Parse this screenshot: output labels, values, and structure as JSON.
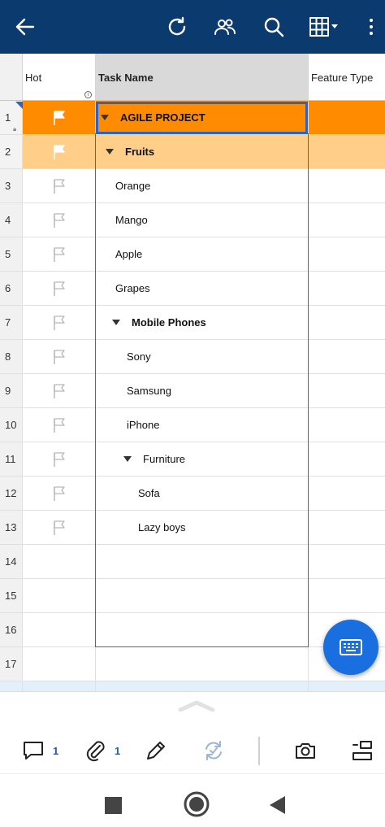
{
  "topbar": {
    "icons": [
      "back-arrow-icon",
      "refresh-icon",
      "users-icon",
      "search-icon",
      "grid-view-icon",
      "more-vert-icon"
    ]
  },
  "grid": {
    "columns": [
      "Hot",
      "Task Name",
      "Feature Type"
    ],
    "rows": [
      {
        "num": "1",
        "task": "AGILE PROJECT",
        "indent": 0,
        "parent": true,
        "bold": true,
        "flag": true
      },
      {
        "num": "2",
        "task": "Fruits",
        "indent": 1,
        "parent": true,
        "bold": true,
        "flag": true
      },
      {
        "num": "3",
        "task": "Orange",
        "indent": 2,
        "parent": false,
        "bold": false,
        "flag": true
      },
      {
        "num": "4",
        "task": "Mango",
        "indent": 2,
        "parent": false,
        "bold": false,
        "flag": true
      },
      {
        "num": "5",
        "task": "Apple",
        "indent": 2,
        "parent": false,
        "bold": false,
        "flag": true
      },
      {
        "num": "6",
        "task": "Grapes",
        "indent": 2,
        "parent": false,
        "bold": false,
        "flag": true
      },
      {
        "num": "7",
        "task": "Mobile Phones",
        "indent": 2,
        "parent": true,
        "bold": true,
        "flag": true
      },
      {
        "num": "8",
        "task": "Sony",
        "indent": 3,
        "parent": false,
        "bold": false,
        "flag": true
      },
      {
        "num": "9",
        "task": "Samsung",
        "indent": 3,
        "parent": false,
        "bold": false,
        "flag": true
      },
      {
        "num": "10",
        "task": "iPhone",
        "indent": 3,
        "parent": false,
        "bold": false,
        "flag": true
      },
      {
        "num": "11",
        "task": "Furniture",
        "indent": 3,
        "parent": true,
        "bold": false,
        "flag": true
      },
      {
        "num": "12",
        "task": "Sofa",
        "indent": 4,
        "parent": false,
        "bold": false,
        "flag": true
      },
      {
        "num": "13",
        "task": "Lazy boys",
        "indent": 4,
        "parent": false,
        "bold": false,
        "flag": true
      },
      {
        "num": "14",
        "task": "",
        "indent": 0,
        "parent": false,
        "bold": false,
        "flag": false
      },
      {
        "num": "15",
        "task": "",
        "indent": 0,
        "parent": false,
        "bold": false,
        "flag": false
      },
      {
        "num": "16",
        "task": "",
        "indent": 0,
        "parent": false,
        "bold": false,
        "flag": false
      },
      {
        "num": "17",
        "task": "",
        "indent": 0,
        "parent": false,
        "bold": false,
        "flag": false
      }
    ]
  },
  "colors": {
    "topbar": "#0b3a6e",
    "highlight_row": "#ff8c00",
    "highlight_row_light": "#ffcf8a",
    "selection": "#2a63c9",
    "range": "#e03030",
    "fab": "#1a6fe0"
  },
  "fab": {
    "icon": "keyboard-icon"
  },
  "bottom_actions": {
    "comments_count": "1",
    "attachments_count": "1"
  }
}
